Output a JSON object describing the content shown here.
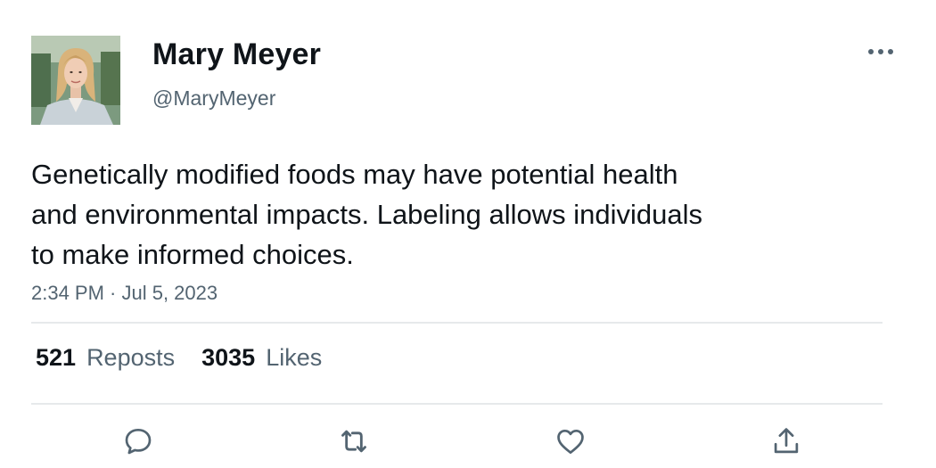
{
  "author": {
    "display_name": "Mary Meyer",
    "handle": "@MaryMeyer",
    "avatar_icon": "profile-photo"
  },
  "tweet": {
    "text": "Genetically modified foods may have potential health\nand environmental impacts. Labeling allows individuals\nto make informed choices.",
    "timestamp": "2:34 PM · Jul 5, 2023"
  },
  "stats": {
    "reposts_count": "521",
    "reposts_label": "Reposts",
    "likes_count": "3035",
    "likes_label": "Likes"
  },
  "actions": {
    "more_icon": "more-horizontal-icon",
    "reply_icon": "reply-icon",
    "repost_icon": "repost-icon",
    "like_icon": "heart-icon",
    "share_icon": "share-icon"
  },
  "colors": {
    "text_primary": "#0f1419",
    "text_secondary": "#536471",
    "divider": "#e6e9eb"
  }
}
